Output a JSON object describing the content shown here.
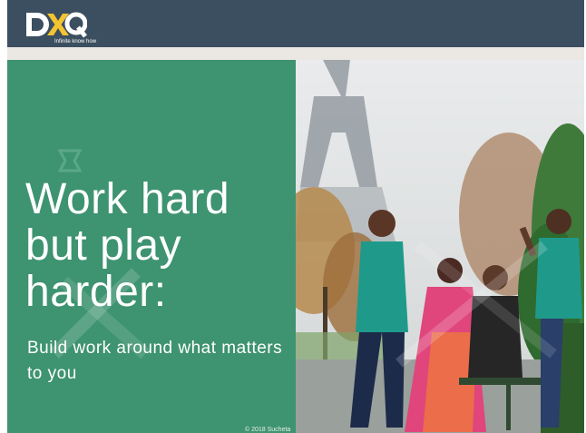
{
  "slide": {
    "logo_text": "DXQ",
    "logo_tagline": "Infinite know how",
    "headline": "Work hard but play harder:",
    "subheadline": "Build work around what matters to you",
    "copyright": "© 2018 Sucheta"
  },
  "colors": {
    "topbar": "#3b4f60",
    "panel": "#3e9371",
    "logo_accent": "#f4c430",
    "text": "#ffffff"
  }
}
